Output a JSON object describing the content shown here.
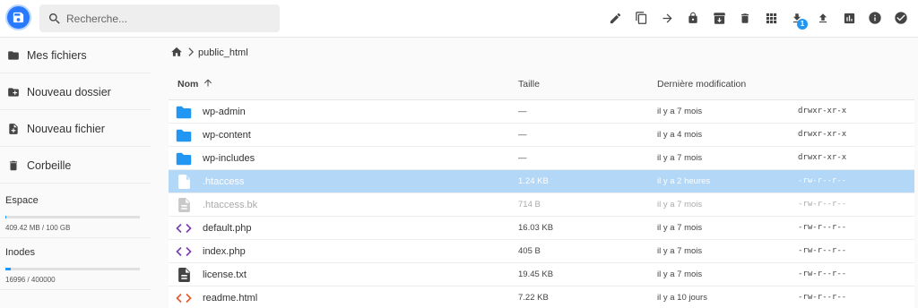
{
  "search": {
    "placeholder": "Recherche..."
  },
  "toolbar": {
    "icons": [
      "edit-icon",
      "copy-icon",
      "move-icon",
      "lock-icon",
      "archive-icon",
      "delete-icon",
      "grid-view-icon",
      "download-icon",
      "upload-icon",
      "info-chart-icon",
      "info-icon",
      "select-check-icon"
    ],
    "download_count": "1"
  },
  "sidebar": {
    "items": [
      {
        "label": "Mes fichiers",
        "icon": "folder-icon"
      },
      {
        "label": "Nouveau dossier",
        "icon": "new-folder-icon"
      },
      {
        "label": "Nouveau fichier",
        "icon": "new-file-icon"
      },
      {
        "label": "Corbeille",
        "icon": "trash-icon"
      }
    ],
    "space": {
      "title": "Espace",
      "value": "409.42 MB / 100 GB",
      "fraction": 0.004
    },
    "inodes": {
      "title": "Inodes",
      "value": "16996 / 400000",
      "fraction": 0.042
    }
  },
  "breadcrumb": {
    "home_icon": "home-icon",
    "path": "public_html"
  },
  "columns": {
    "name": "Nom",
    "size": "Taille",
    "modified": "Dernière modification"
  },
  "files": [
    {
      "name": "wp-admin",
      "size": "—",
      "modified": "il y a 7 mois",
      "perm": "drwxr-xr-x",
      "type": "folder"
    },
    {
      "name": "wp-content",
      "size": "—",
      "modified": "il y a 4 mois",
      "perm": "drwxr-xr-x",
      "type": "folder"
    },
    {
      "name": "wp-includes",
      "size": "—",
      "modified": "il y a 7 mois",
      "perm": "drwxr-xr-x",
      "type": "folder"
    },
    {
      "name": ".htaccess",
      "size": "1.24 KB",
      "modified": "il y a 2 heures",
      "perm": "-rw-r--r--",
      "type": "file",
      "selected": true
    },
    {
      "name": ".htaccess.bk",
      "size": "714 B",
      "modified": "il y a 7 mois",
      "perm": "-rw-r--r--",
      "type": "file",
      "dimmed": true
    },
    {
      "name": "default.php",
      "size": "16.03 KB",
      "modified": "il y a 7 mois",
      "perm": "-rw-r--r--",
      "type": "code"
    },
    {
      "name": "index.php",
      "size": "405 B",
      "modified": "il y a 7 mois",
      "perm": "-rw-r--r--",
      "type": "code"
    },
    {
      "name": "license.txt",
      "size": "19.45 KB",
      "modified": "il y a 7 mois",
      "perm": "-rw-r--r--",
      "type": "text"
    },
    {
      "name": "readme.html",
      "size": "7.22 KB",
      "modified": "il y a 10 jours",
      "perm": "-rw-r--r--",
      "type": "html"
    }
  ],
  "colors": {
    "accent": "#2196f3",
    "selected_row": "#b3d7f7",
    "folder": "#2196f3",
    "code": "#7b3fb0",
    "html": "#e4592b"
  }
}
